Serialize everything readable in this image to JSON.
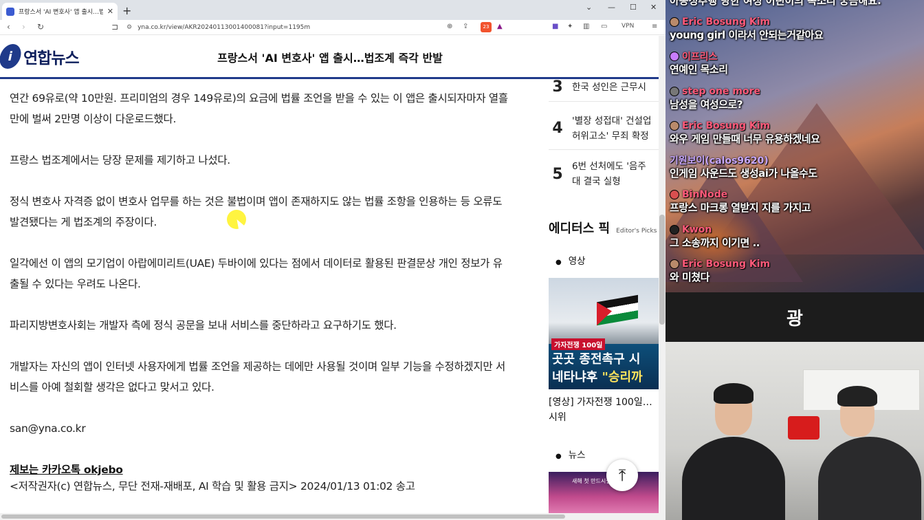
{
  "browser": {
    "tab_title": "프랑스서 'AI 변호사' 앱 출시…법",
    "tab_close": "✕",
    "new_tab": "+",
    "url": "yna.co.kr/view/AKR20240113001400081?input=1195m",
    "brave_badge": "23",
    "vpn_label": "VPN"
  },
  "site": {
    "logo_text": "연합뉴스",
    "header_title": "프랑스서 'AI 변호사' 앱 출시…법조계 즉각 반발"
  },
  "article": {
    "paragraphs": [
      "연간 69유로(약 10만원. 프리미엄의 경우 149유로)의 요금에 법률 조언을 받을 수 있는 이 앱은 출시되자마자 열흘 만에 벌써 2만명 이상이 다운로드했다.",
      "프랑스 법조계에서는 당장 문제를 제기하고 나섰다.",
      "정식 변호사 자격증 없이 변호사 업무를 하는 것은 불법이며 앱이 존재하지도 않는 법률 조항을 인용하는 등 오류도 발견됐다는 게 법조계의 주장이다.",
      "일각에선 이 앱의 모기업이 아랍에미리트(UAE) 두바이에 있다는 점에서 데이터로 활용된 판결문상 개인 정보가 유출될 수 있다는 우려도 나온다.",
      "파리지방변호사회는 개발자 측에 정식 공문을 보내 서비스를 중단하라고 요구하기도 했다.",
      "개발자는 자신의 앱이 인터넷 사용자에게 법률 조언을 제공하는 데에만 사용될 것이며 일부 기능을 수정하겠지만 서비스를 아예 철회할 생각은 없다고 맞서고 있다."
    ],
    "email": "san@yna.co.kr",
    "tip": "제보는 카카오톡 okjebo",
    "copyright": "<저작권자(c) 연합뉴스, 무단 전재-재배포, AI 학습 및 활용 금지>  2024/01/13 01:02 송고"
  },
  "sidebar": {
    "rank": [
      {
        "num": "3",
        "text": "한국 성인은 근무시"
      },
      {
        "num": "4",
        "line1": "'별장 성접대' 건설업",
        "line2": "허위고소' 무죄 확정"
      },
      {
        "num": "5",
        "line1": "6번 선처에도 '음주",
        "line2": "대 결국 실형"
      }
    ],
    "picks_title": "에디터스 픽",
    "picks_sub": "Editor's Picks",
    "cat_video": "영상",
    "thumb_tag": "가자전쟁 100일",
    "thumb_line1": "곳곳 종전촉구 시",
    "thumb_line2_a": "네타냐후 ",
    "thumb_line2_b": "\"승리까",
    "caption1": "[영상] 가자전쟁 100일… 시위",
    "cat_news": "뉴스",
    "thumb2_text": "새해 첫 만드시설 도입",
    "top_button": "⤒"
  },
  "stream": {
    "chat_top": "아동성추행 당한 여성 어린이의 목소리 궁금해요.",
    "messages": [
      {
        "user": "Eric Bosung Kim",
        "user_color": "#ff5a7a",
        "avatar_color": "#b98a6b",
        "text": "young girl 이라서 안되는거같아요"
      },
      {
        "user": "이프리스",
        "user_color": "#ff5a7a",
        "avatar_color": "#c77dff",
        "text": "연예인 목소리"
      },
      {
        "user": "step one more",
        "user_color": "#ff5a7a",
        "avatar_color": "#777777",
        "text": "남성을 여성으로?"
      },
      {
        "user": "Eric Bosung Kim",
        "user_color": "#ff5a7a",
        "avatar_color": "#b98a6b",
        "text": "와우 게임 만들때 너무 유용하겠네요"
      },
      {
        "user": "기원보이(calos9620)",
        "user_color": "#c9a8ff",
        "avatar_color": "#000000",
        "text": "인게임 사운드도 생성ai가 나올수도"
      },
      {
        "user": "BinNode",
        "user_color": "#ff5a7a",
        "avatar_color": "#d94f4f",
        "text": "프랑스 마크롱 열받지 지를 가지고"
      },
      {
        "user": "Kwon",
        "user_color": "#ff5a7a",
        "avatar_color": "#222222",
        "text": "그 소송까지 이기면 .."
      },
      {
        "user": "Eric Bosung Kim",
        "user_color": "#ff5a7a",
        "avatar_color": "#b98a6b",
        "text": "와 미쳤다"
      }
    ],
    "ad_text": "광"
  }
}
